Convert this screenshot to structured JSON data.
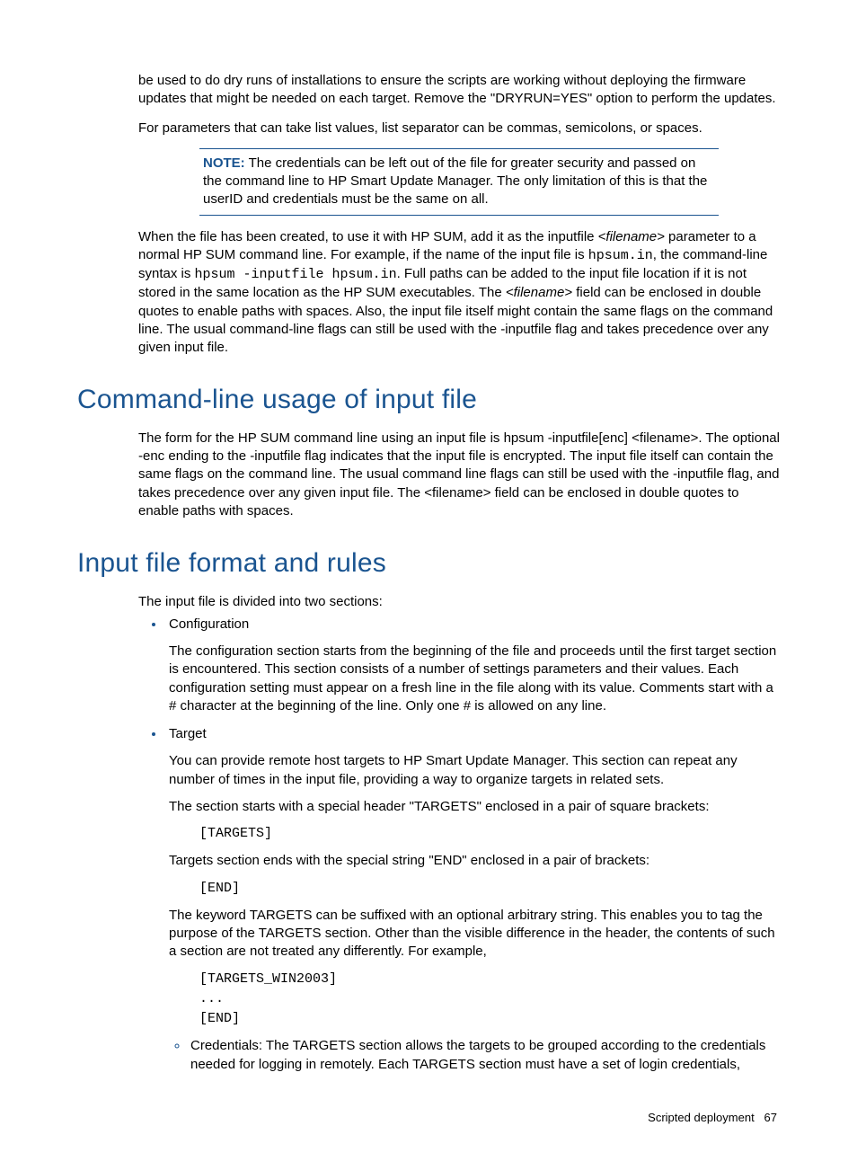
{
  "intro": {
    "p1": "be used to do dry runs of installations to ensure the scripts are working without deploying the firmware updates that might be needed on each target. Remove the \"DRYRUN=YES\" option to perform the updates.",
    "p2": "For parameters that can take list values, list separator can be commas, semicolons, or spaces."
  },
  "note": {
    "label": "NOTE:",
    "text": " The credentials can be left out of the file for greater security and passed on the command line to HP Smart Update Manager. The only limitation of this is that the userID and credentials must be the same on all."
  },
  "p3": {
    "a": "When the file has been created, to use it with HP SUM, add it as the inputfile ",
    "fn1": "<filename>",
    "b": " parameter to a normal HP SUM command line. For example, if the name of the input file is ",
    "code1": "hpsum.in",
    "c": ", the command-line syntax is ",
    "code2": "hpsum -inputfile hpsum.in",
    "d": ". Full paths can be added to the input file location if it is not stored in the same location as the HP SUM executables. The ",
    "fn2": "<filename>",
    "e": " field can be enclosed in double quotes to enable paths with spaces. Also, the input file itself might contain the same flags on the command line. The usual command-line flags can still be used with the -inputfile flag and takes precedence over any given input file."
  },
  "h1": "Command-line usage of input file",
  "s1p1": "The form for the HP SUM command line using an input file is hpsum -inputfile[enc] <filename>. The optional -enc ending to the -inputfile flag indicates that the input file is encrypted. The input file itself can contain the same flags on the command line. The usual command line flags can still be used with the -inputfile flag, and takes precedence over any given input file. The <filename> field can be enclosed in double quotes to enable paths with spaces.",
  "h2": "Input file format and rules",
  "s2p1": "The input file is divided into two sections:",
  "bullets": {
    "cfg": {
      "title": "Configuration",
      "body": "The configuration section starts from the beginning of the file and proceeds until the first target section is encountered. This section consists of a number of settings parameters and their values. Each configuration setting must appear on a fresh line in the file along with its value. Comments start with a # character at the beginning of the line. Only one # is allowed on any line."
    },
    "tgt": {
      "title": "Target",
      "p1": "You can provide remote host targets to HP Smart Update Manager. This section can repeat any number of times in the input file, providing a way to organize targets in related sets.",
      "p2": "The section starts with a special header \"TARGETS\" enclosed in a pair of square brackets:",
      "code1": "[TARGETS]",
      "p3": "Targets section ends with the special string \"END\" enclosed in a pair of brackets:",
      "code2": "[END]",
      "p4": "The keyword TARGETS can be suffixed with an optional arbitrary string. This enables you to tag the purpose of the TARGETS section. Other than the visible difference in the header, the contents of such a section are not treated any differently. For example,",
      "code3a": "[TARGETS_WIN2003]",
      "code3b": "...",
      "code3c": "[END]",
      "sub": "Credentials: The TARGETS section allows the targets to be grouped according to the credentials needed for logging in remotely. Each TARGETS section must have a set of login credentials,"
    }
  },
  "footer": {
    "section": "Scripted deployment",
    "page": "67"
  }
}
